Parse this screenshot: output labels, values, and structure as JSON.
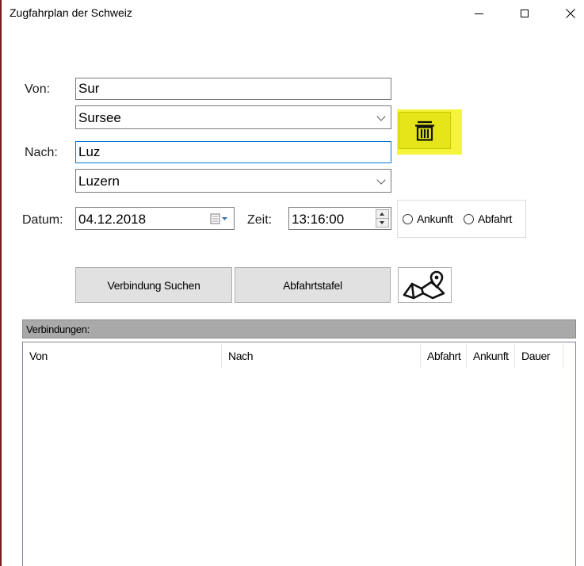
{
  "window": {
    "title": "Zugfahrplan der Schweiz",
    "minimize_glyph": "",
    "close_glyph": "✕"
  },
  "form": {
    "von_label": "Von:",
    "von_input": "Sur",
    "von_select": "Sursee",
    "nach_label": "Nach:",
    "nach_input": "Luz",
    "nach_select": "Luzern",
    "datum_label": "Datum:",
    "datum_value": "04.12.2018",
    "zeit_label": "Zeit:",
    "zeit_value": "13:16:00",
    "radio_ankunft": "Ankunft",
    "radio_abfahrt": "Abfahrt"
  },
  "buttons": {
    "trash_icon": "trash-icon",
    "verbindung_suchen": "Verbindung Suchen",
    "abfahrtstafel": "Abfahrtstafel",
    "map_icon": "map-pin-icon"
  },
  "connections": {
    "group_label": "Verbindungen:",
    "columns": [
      "Von",
      "Nach",
      "Abfahrt",
      "Ankunft",
      "Dauer"
    ],
    "rows": []
  },
  "colors": {
    "highlight": "#f4f53a",
    "button_bg": "#e1e1e1",
    "focus_border": "#0078d7",
    "group_bar": "#a9a9a9"
  }
}
